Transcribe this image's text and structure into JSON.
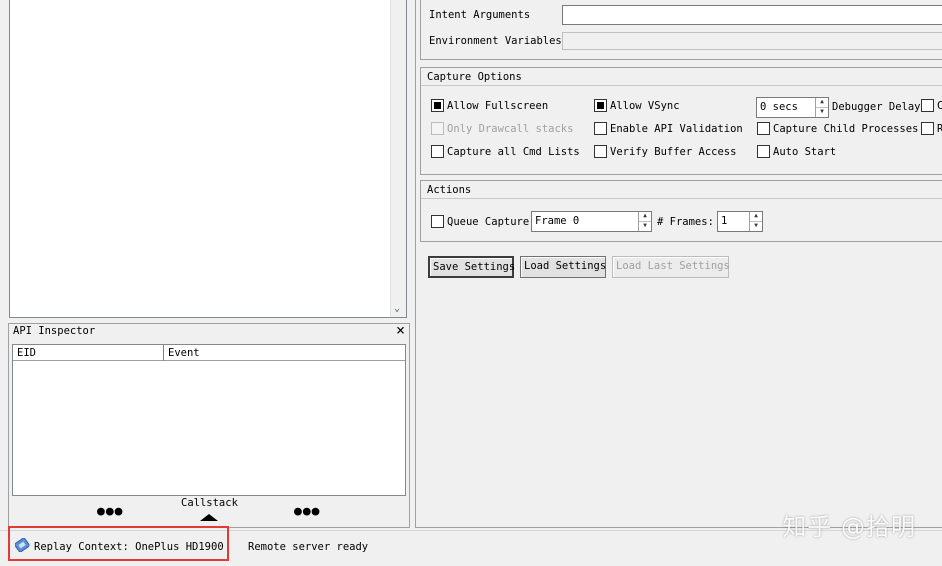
{
  "left_top_panel": {},
  "api_inspector": {
    "title": "API Inspector",
    "columns": [
      "EID",
      "Event"
    ],
    "callstack_label": "Callstack"
  },
  "capture_settings": {
    "intent_arguments_label": "Intent Arguments",
    "intent_arguments_value": "",
    "environment_variables_label": "Environment Variables",
    "environment_variables_value": ""
  },
  "capture_options": {
    "title": "Capture Options",
    "allow_fullscreen": {
      "label": "Allow Fullscreen",
      "checked": true
    },
    "allow_vsync": {
      "label": "Allow VSync",
      "checked": true
    },
    "debugger_delay_value": "0 secs",
    "debugger_delay_label": "Debugger Delay",
    "only_drawcall_stacks": {
      "label": "Only Drawcall stacks",
      "checked": false,
      "disabled": true
    },
    "enable_api_validation": {
      "label": "Enable API Validation",
      "checked": false
    },
    "capture_child_processes": {
      "label": "Capture Child Processes",
      "checked": false
    },
    "capture_all_cmd_lists": {
      "label": "Capture all Cmd Lists",
      "checked": false
    },
    "verify_buffer_access": {
      "label": "Verify Buffer Access",
      "checked": false
    },
    "auto_start": {
      "label": "Auto Start",
      "checked": false
    },
    "cut_off_col4_row1": "C",
    "cut_off_col4_row2": "R"
  },
  "actions": {
    "title": "Actions",
    "queue_capture": {
      "label": "Queue Capture",
      "checked": false
    },
    "frame_value": "Frame 0",
    "frames_label": "# Frames:",
    "frames_value": "1"
  },
  "buttons": {
    "save_settings": "Save Settings",
    "load_settings": "Load Settings",
    "load_last_settings": "Load Last Settings"
  },
  "status_bar": {
    "replay_context": "Replay Context: OnePlus HD1900",
    "remote_status": "Remote server ready"
  },
  "watermark": "知乎 @拾明",
  "colors": {
    "highlight": "#e53935",
    "window_bg": "#f0f0f0"
  }
}
